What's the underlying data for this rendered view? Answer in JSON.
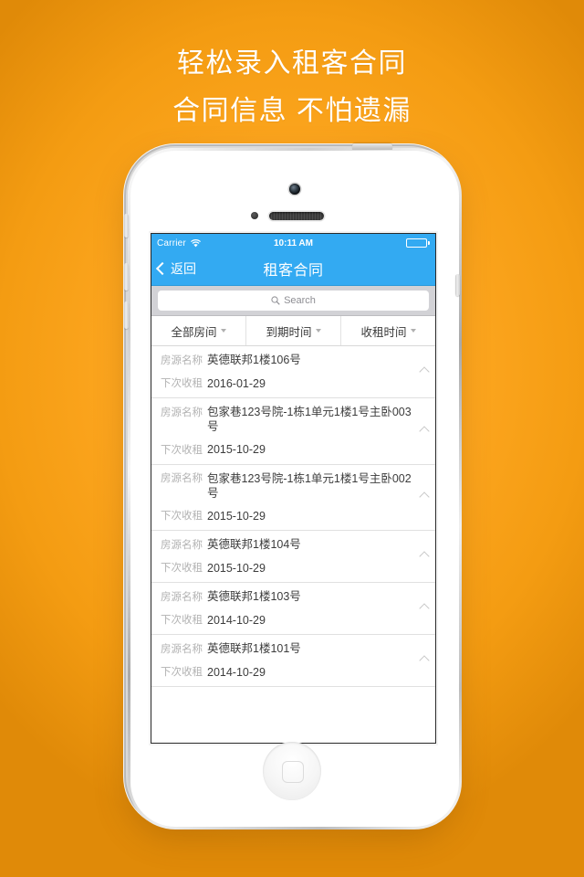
{
  "poster": {
    "background_color": "#FCA51E",
    "headline_line1": "轻松录入租客合同",
    "headline_line2": "合同信息 不怕遗漏",
    "headline_color": "#FFFFFF"
  },
  "device": {
    "name": "iPhone 5 white",
    "accent_color": "#33AAF2"
  },
  "status_bar": {
    "carrier": "Carrier",
    "wifi_icon": "wifi-icon",
    "time": "10:11 AM",
    "battery_icon": "battery-full-icon"
  },
  "nav_bar": {
    "back_icon": "chevron-left-icon",
    "back_label": "返回",
    "title": "租客合同"
  },
  "search": {
    "icon": "search-icon",
    "placeholder": "Search",
    "value": ""
  },
  "filters": [
    {
      "label": "全部房间",
      "icon": "chevron-down-icon"
    },
    {
      "label": "到期时间",
      "icon": "chevron-down-icon"
    },
    {
      "label": "收租时间",
      "icon": "chevron-down-icon"
    }
  ],
  "list": {
    "name_label": "房源名称",
    "date_label": "下次收租",
    "disclosure_icon": "chevron-right-icon",
    "items": [
      {
        "name": "英德联邦1楼106号",
        "next_rent": "2016-01-29"
      },
      {
        "name": "包家巷123号院-1栋1单元1楼1号主卧003号",
        "next_rent": "2015-10-29"
      },
      {
        "name": "包家巷123号院-1栋1单元1楼1号主卧002号",
        "next_rent": "2015-10-29"
      },
      {
        "name": "英德联邦1楼104号",
        "next_rent": "2015-10-29"
      },
      {
        "name": "英德联邦1楼103号",
        "next_rent": "2014-10-29"
      },
      {
        "name": "英德联邦1楼101号",
        "next_rent": "2014-10-29"
      }
    ]
  }
}
